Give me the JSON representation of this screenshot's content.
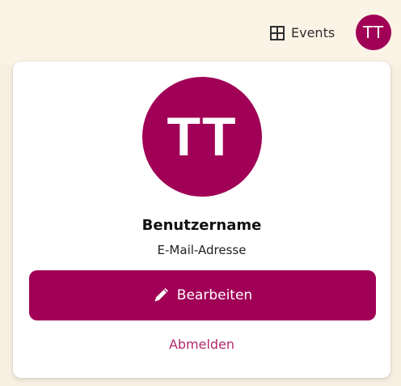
{
  "header": {
    "events_label": "Events",
    "events_icon": "grid-icon",
    "avatar_initials": "TT"
  },
  "profile": {
    "avatar_initials": "TT",
    "username_label": "Benutzername",
    "email_label": "E-Mail-Adresse",
    "edit_label": "Bearbeiten",
    "edit_icon": "pencil-icon",
    "logout_label": "Abmelden"
  },
  "colors": {
    "brand": "#a00056",
    "background": "#fbf3e6",
    "link": "#b22a6d"
  }
}
